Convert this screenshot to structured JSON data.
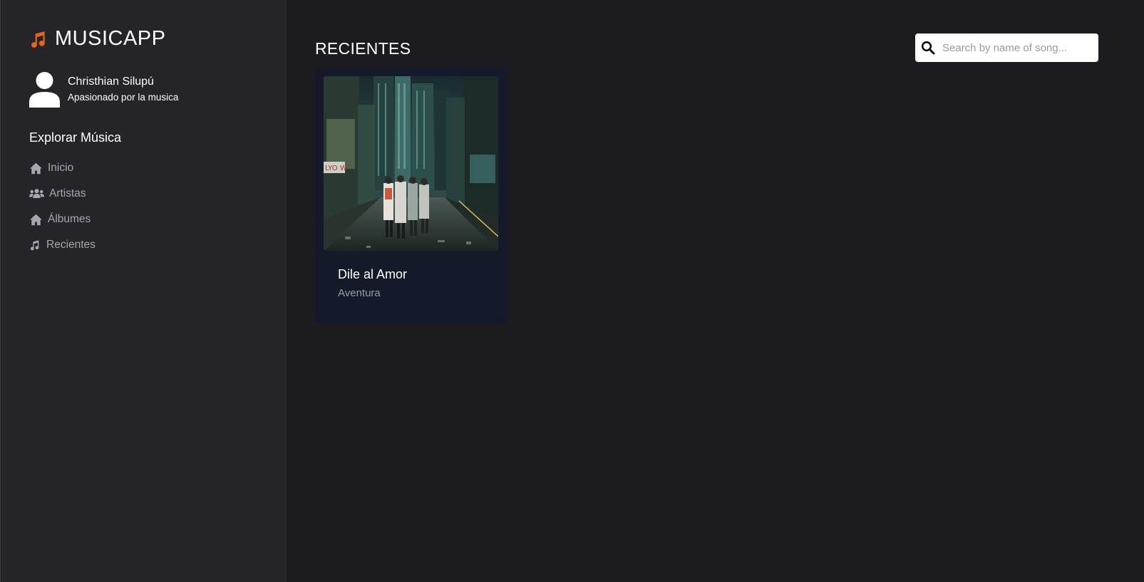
{
  "brand": {
    "name": "MUSICAPP",
    "icon": "music-note-icon",
    "accent_color": "#e8641b"
  },
  "profile": {
    "name": "Christhian Silupú",
    "bio": "Apasionado por la musica",
    "icon": "user-icon"
  },
  "sidebar": {
    "section_title": "Explorar Música",
    "items": [
      {
        "label": "Inicio",
        "icon": "home-icon"
      },
      {
        "label": "Artistas",
        "icon": "users-icon"
      },
      {
        "label": "Álbumes",
        "icon": "home-icon"
      },
      {
        "label": "Recientes",
        "icon": "music-note-icon"
      }
    ]
  },
  "main": {
    "title": "RECIENTES",
    "search": {
      "placeholder": "Search by name of song...",
      "value": ""
    },
    "cards": [
      {
        "title": "Dile al Amor",
        "artist": "Aventura",
        "image": "album-cover-city-night"
      }
    ]
  },
  "colors": {
    "sidebar_bg": "#252529",
    "main_bg": "#1c1b20",
    "card_bg": "#141a2a",
    "nav_text": "#a4a7ae"
  }
}
